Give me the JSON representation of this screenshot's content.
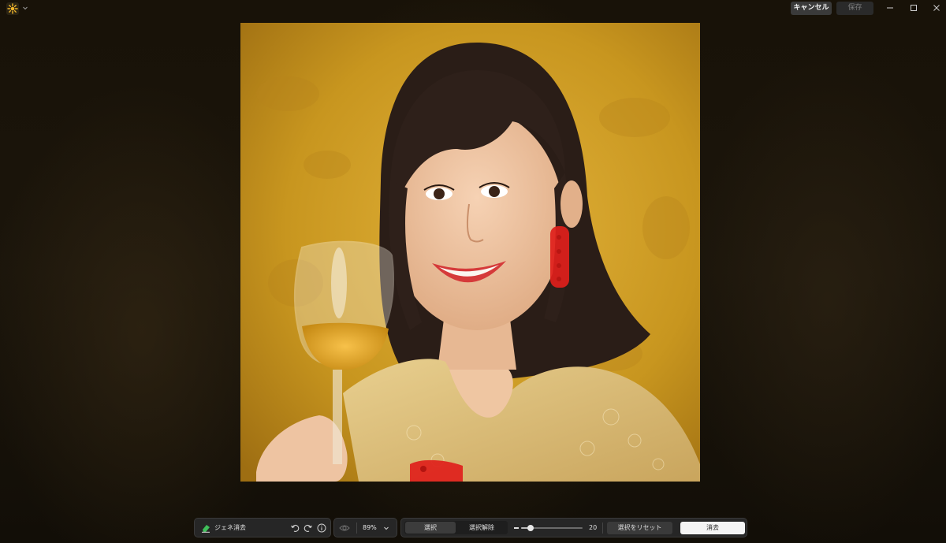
{
  "header": {
    "cancel_label": "キャンセル",
    "save_label": "保存"
  },
  "toolbar": {
    "tool_label": "ジェネ消去",
    "zoom_label": "89%",
    "select_label": "選択",
    "deselect_label": "選択解除",
    "brush_size": "20",
    "brush_size_fraction": 0.15,
    "reset_selection_label": "選択をリセット",
    "erase_label": "消去"
  },
  "colors": {
    "accent_icon": "#f0b429",
    "eraser_icon": "#3fbf5a",
    "selection_mask": "#e0201b"
  }
}
